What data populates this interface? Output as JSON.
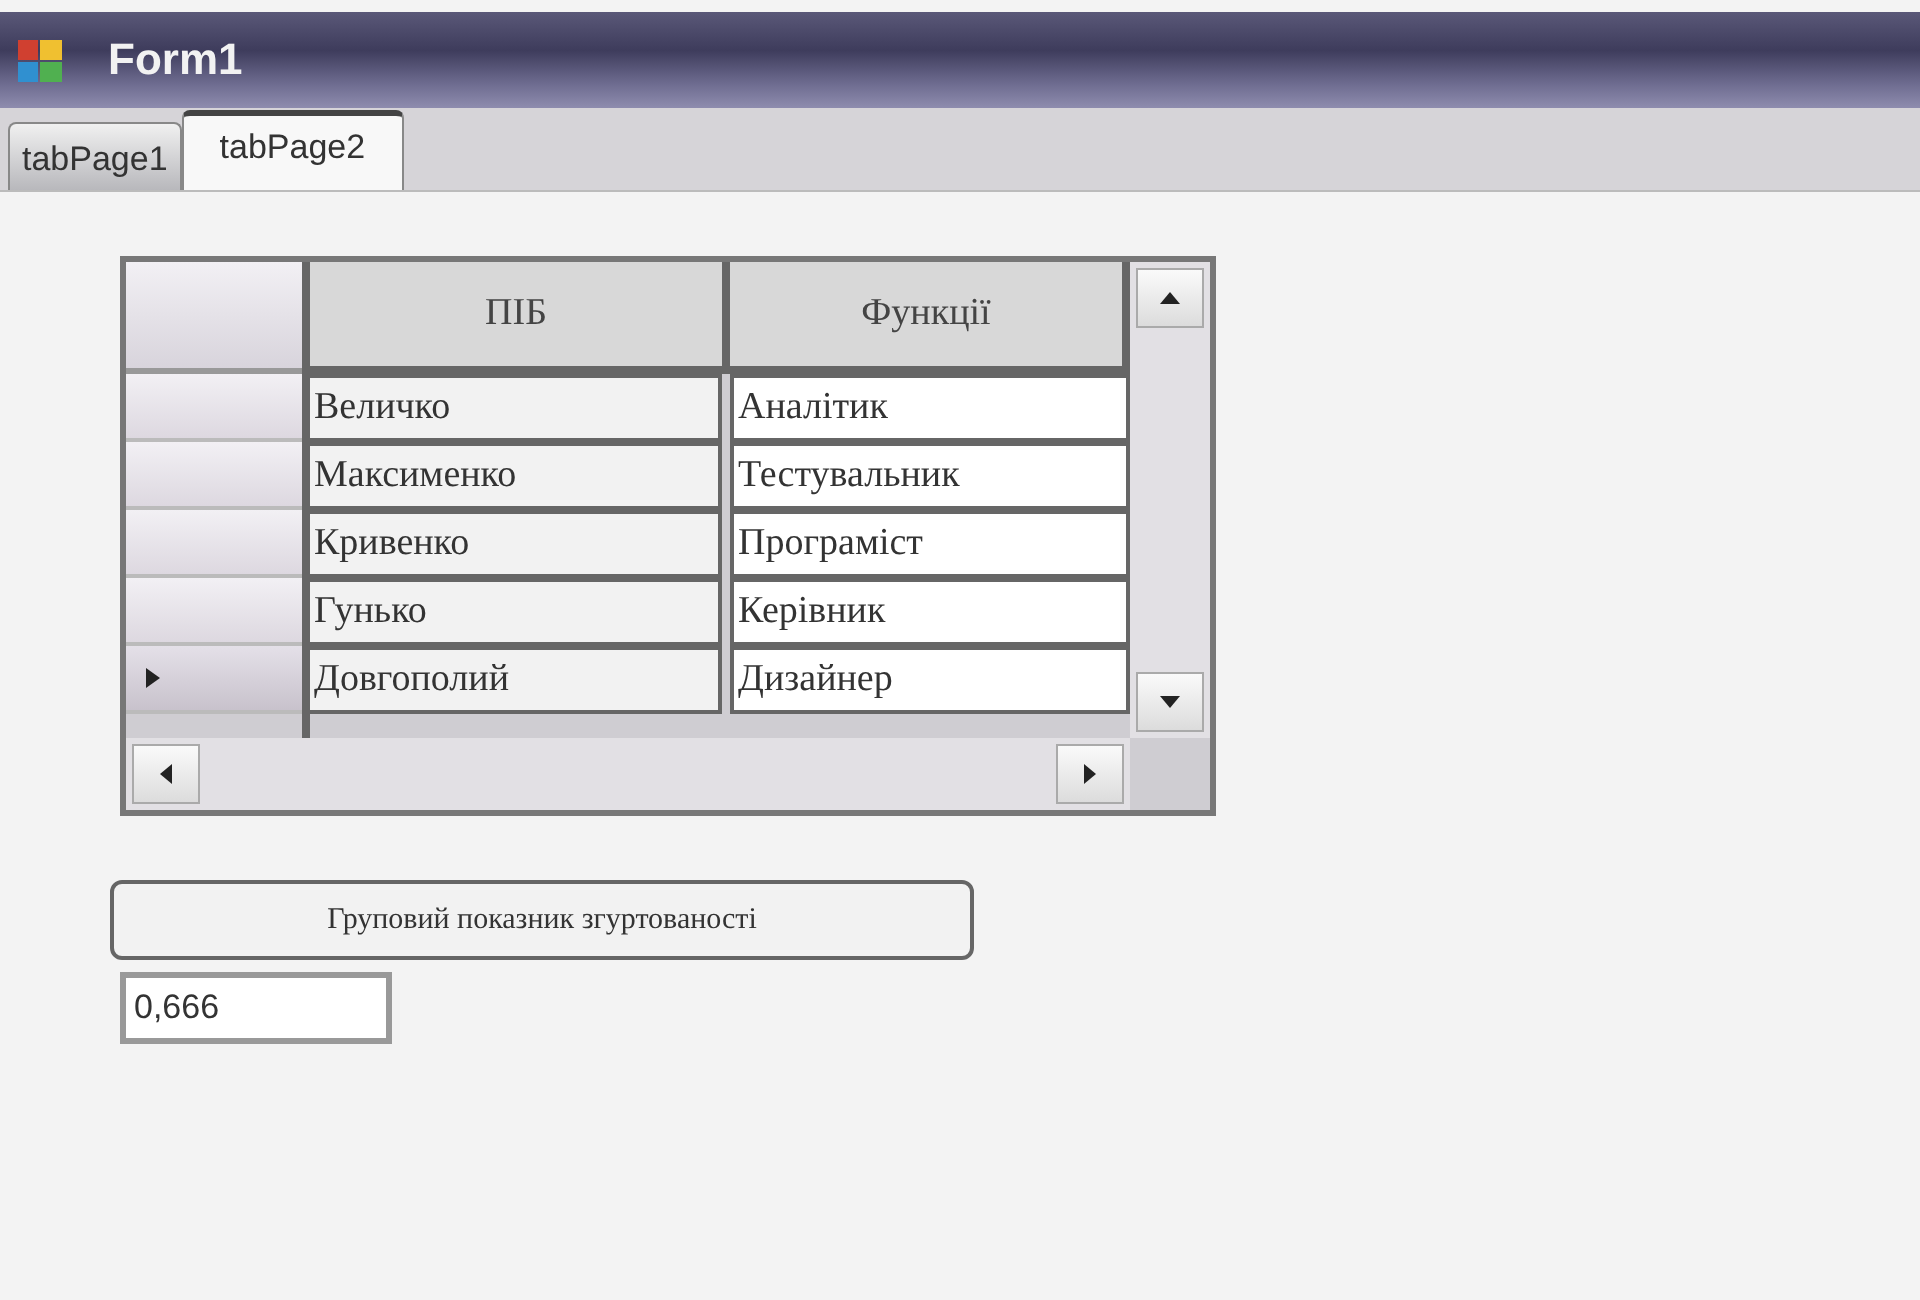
{
  "window": {
    "title": "Form1"
  },
  "tabs": [
    {
      "label": "tabPage1",
      "selected": false
    },
    {
      "label": "tabPage2",
      "selected": true
    }
  ],
  "table": {
    "columns": [
      "ПІБ",
      "Функції"
    ],
    "rows": [
      {
        "cells": [
          "Величко",
          "Аналітик"
        ],
        "selected": false
      },
      {
        "cells": [
          "Максименко",
          "Тестувальник"
        ],
        "selected": false
      },
      {
        "cells": [
          "Кривенко",
          "Програміст"
        ],
        "selected": false
      },
      {
        "cells": [
          "Гунько",
          "Керівник"
        ],
        "selected": false
      },
      {
        "cells": [
          "Довгополий",
          "Дизайнер"
        ],
        "selected": true
      }
    ]
  },
  "button": {
    "label": "Груповий показник згуртованості"
  },
  "result": {
    "value": "0,666"
  }
}
